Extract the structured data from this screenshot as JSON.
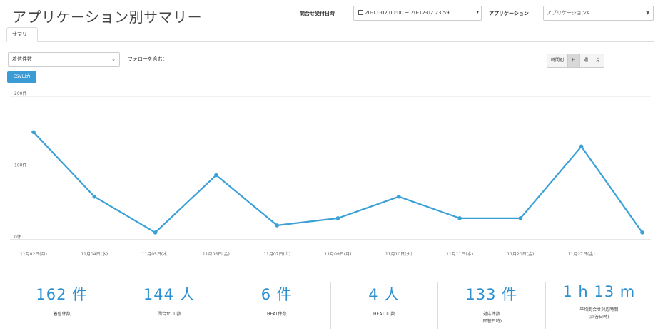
{
  "page": {
    "title": "アプリケーション別サマリー"
  },
  "filters": {
    "date_label": "問合せ受付日時",
    "date_value": "20-11-02 00:00 ~ 20-12-02 23:59",
    "app_label": "アプリケーション",
    "app_value": "アプリケーションA"
  },
  "tabs": [
    "サマリー"
  ],
  "controls": {
    "metric_select": "着信件数",
    "follow_label": "フォローを含む：",
    "period_buttons": [
      "時間別",
      "日",
      "週",
      "月"
    ],
    "active_period": "日",
    "csv_button": "CSV出力"
  },
  "chart_data": {
    "type": "line",
    "x": [
      "11月02日(月)",
      "11月04日(水)",
      "11月05日(木)",
      "11月06日(金)",
      "11月07日(土)",
      "11月09日(月)",
      "11月10日(火)",
      "11月11日(水)",
      "11月20日(金)",
      "11月27日(金)",
      ""
    ],
    "series": [
      {
        "values": [
          150,
          60,
          10,
          90,
          20,
          30,
          60,
          30,
          30,
          130,
          10
        ]
      }
    ],
    "y_ticks": [
      "0件",
      "100件",
      "200件"
    ],
    "ylim": [
      0,
      200
    ],
    "color": "#3aa0d8",
    "grid": true
  },
  "stats": [
    {
      "value": "162 件",
      "label": "着信件数",
      "label2": ""
    },
    {
      "value": "144 人",
      "label": "問合せUU数",
      "label2": ""
    },
    {
      "value": "6 件",
      "label": "HEAT件数",
      "label2": ""
    },
    {
      "value": "4 人",
      "label": "HEATUU数",
      "label2": ""
    },
    {
      "value": "133 件",
      "label": "対応件数",
      "label2": "(回答日時)"
    },
    {
      "value": "1 h 13 m",
      "label": "平均問合せ対応時間",
      "label2": "(回答日時)"
    }
  ]
}
